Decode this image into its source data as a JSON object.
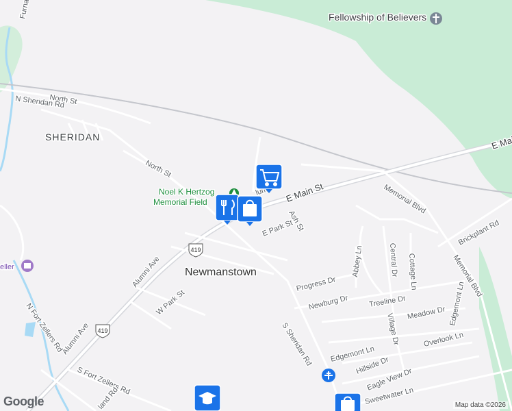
{
  "labels": {
    "fellowship": "Fellowship of Believers",
    "sheridan": "SHERIDAN",
    "town": "Newmanstown",
    "park_line1": "Noel K Hertzog",
    "park_line2": "Memorial Field",
    "eller": "eller",
    "alumni_partial": "lum"
  },
  "streets": {
    "furnace_rd": "Furnace Rd",
    "north_st_top": "North St",
    "n_sheridan_rd": "N Sheridan Rd",
    "north_st": "North St",
    "e_main_st": "E Main St",
    "e_main_right": "E Main",
    "memorial_blvd_top": "Memorial Blvd",
    "memorial_blvd_side": "Memorial Blvd",
    "ash_st": "Ash St",
    "e_park_st": "E Park St",
    "brickplant_rd": "Brickplant Rd",
    "alumni_ave_upper": "Alumni Ave",
    "alumni_ave_lower": "Alumni Ave",
    "w_park_st": "W Park St",
    "abbey_ln": "Abbey Ln",
    "central_dr": "Central Dr",
    "cottage_ln": "Cottage Ln",
    "progress_dr": "Progress Dr",
    "newburg_dr": "Newburg Dr",
    "treeline_dr": "Treeline Dr",
    "meadow_dr": "Meadow Dr",
    "edgemont_ln_v": "Edgemont Ln",
    "village_dr": "Village Dr",
    "edgemont_ln": "Edgemont Ln",
    "overlook_ln": "Overlook Ln",
    "n_fort_zellers_rd": "N Fort Zellers Rd",
    "s_sheridan_rd": "S Sheridan Rd",
    "hillside_dr": "Hillside Dr",
    "eagle_view_dr": "Eagle View Dr",
    "sweetwater_ln": "Sweetwater Ln",
    "s_fort_zellers_rd": "S Fort Zellers Rd",
    "land_rd": "land Rd"
  },
  "route_shield": "419",
  "markers": [
    {
      "name": "shopping-cart",
      "label": "Grocery store"
    },
    {
      "name": "restaurant",
      "label": "Restaurant"
    },
    {
      "name": "shopping-bag",
      "label": "Shop"
    },
    {
      "name": "school",
      "label": "School"
    },
    {
      "name": "shopping-bag",
      "label": "Shop"
    }
  ],
  "attribution": "Map data ©2026",
  "logo": "Google",
  "colors": {
    "land": "#f3f2f4",
    "park": "#c8ecd5",
    "water": "#a8daf5",
    "road": "#ffffff",
    "highway": "#d9dbe0",
    "marker": "#1a73e8"
  }
}
